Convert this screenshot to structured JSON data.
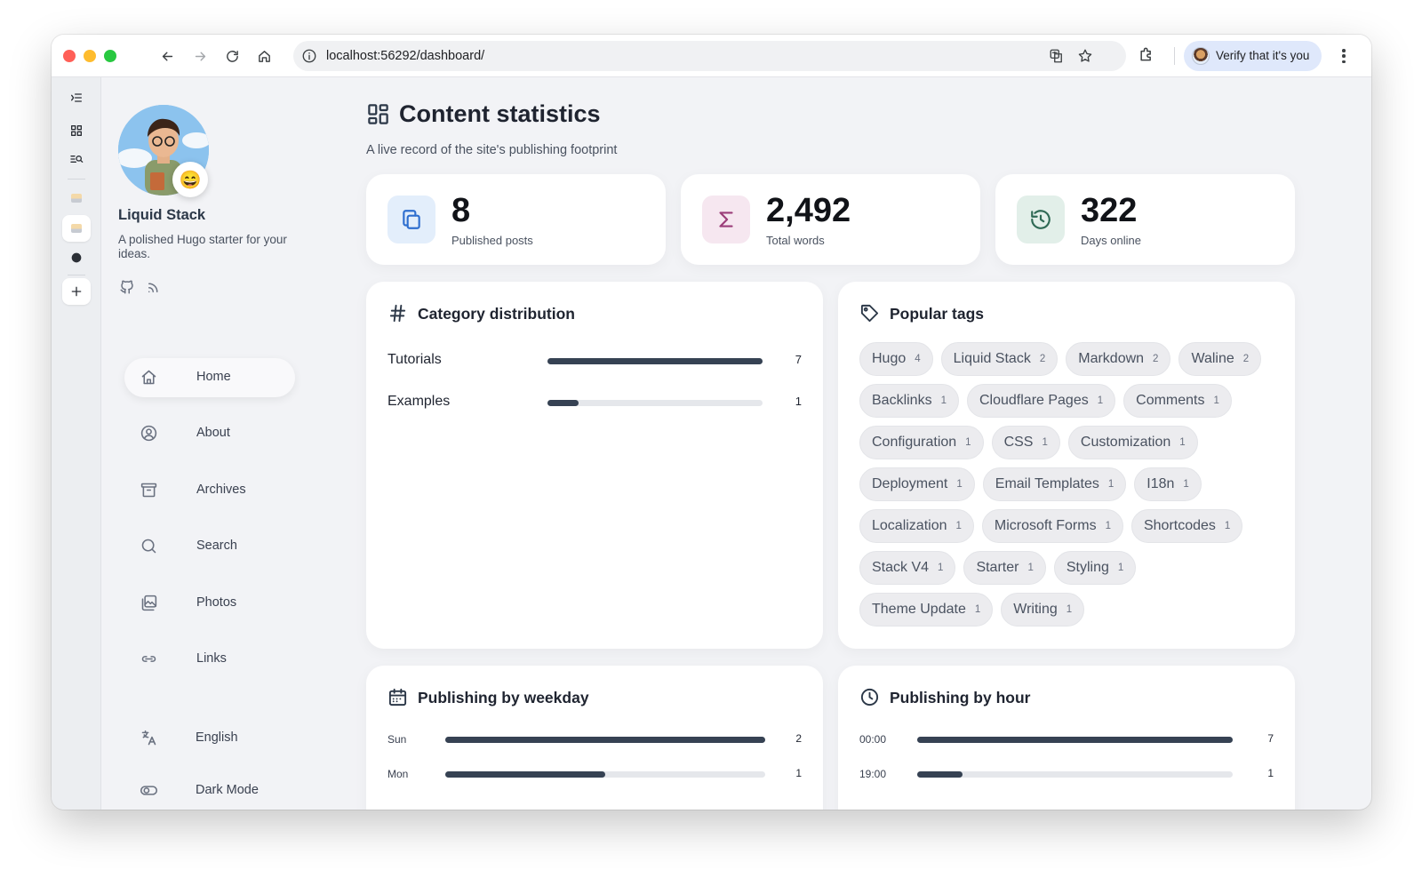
{
  "browser": {
    "url": "localhost:56292/dashboard/",
    "profile_label": "Verify that it's you"
  },
  "site": {
    "title": "Liquid Stack",
    "description": "A polished Hugo starter for your ideas.",
    "avatar_emoji": "😄"
  },
  "menu": [
    {
      "label": "Home",
      "icon": "home-icon",
      "active": true
    },
    {
      "label": "About",
      "icon": "user-circle-icon"
    },
    {
      "label": "Archives",
      "icon": "archive-icon"
    },
    {
      "label": "Search",
      "icon": "search-icon"
    },
    {
      "label": "Photos",
      "icon": "photos-icon"
    },
    {
      "label": "Links",
      "icon": "link-icon"
    }
  ],
  "menu_bottom": [
    {
      "label": "English",
      "icon": "language-icon"
    },
    {
      "label": "Dark Mode",
      "icon": "toggle-icon"
    }
  ],
  "page": {
    "title": "Content statistics",
    "subtitle": "A live record of the site's publishing footprint"
  },
  "stats": [
    {
      "value": "8",
      "label": "Published posts",
      "icon": "copy-icon",
      "accent": "#2f6fcf",
      "bg": "#e3eefb"
    },
    {
      "value": "2,492",
      "label": "Total words",
      "icon": "sigma-icon",
      "accent": "#9b3d79",
      "bg": "#f6e7f0"
    },
    {
      "value": "322",
      "label": "Days online",
      "icon": "history-icon",
      "accent": "#2f6a55",
      "bg": "#e2efe9"
    }
  ],
  "categories": {
    "title": "Category distribution",
    "items": [
      {
        "label": "Tutorials",
        "count": "7",
        "fraction": 1.0
      },
      {
        "label": "Examples",
        "count": "1",
        "fraction": 0.143
      }
    ]
  },
  "tags": {
    "title": "Popular tags",
    "items": [
      {
        "name": "Hugo",
        "count": "4"
      },
      {
        "name": "Liquid Stack",
        "count": "2"
      },
      {
        "name": "Markdown",
        "count": "2"
      },
      {
        "name": "Waline",
        "count": "2"
      },
      {
        "name": "Backlinks",
        "count": "1"
      },
      {
        "name": "Cloudflare Pages",
        "count": "1"
      },
      {
        "name": "Comments",
        "count": "1"
      },
      {
        "name": "Configuration",
        "count": "1"
      },
      {
        "name": "CSS",
        "count": "1"
      },
      {
        "name": "Customization",
        "count": "1"
      },
      {
        "name": "Deployment",
        "count": "1"
      },
      {
        "name": "Email Templates",
        "count": "1"
      },
      {
        "name": "I18n",
        "count": "1"
      },
      {
        "name": "Localization",
        "count": "1"
      },
      {
        "name": "Microsoft Forms",
        "count": "1"
      },
      {
        "name": "Shortcodes",
        "count": "1"
      },
      {
        "name": "Stack V4",
        "count": "1"
      },
      {
        "name": "Starter",
        "count": "1"
      },
      {
        "name": "Styling",
        "count": "1"
      },
      {
        "name": "Theme Update",
        "count": "1"
      },
      {
        "name": "Writing",
        "count": "1"
      }
    ]
  },
  "weekday": {
    "title": "Publishing by weekday",
    "items": [
      {
        "label": "Sun",
        "count": "2",
        "fraction": 1.0
      },
      {
        "label": "Mon",
        "count": "1",
        "fraction": 0.5
      }
    ]
  },
  "hour": {
    "title": "Publishing by hour",
    "items": [
      {
        "label": "00:00",
        "count": "7",
        "fraction": 1.0
      },
      {
        "label": "19:00",
        "count": "1",
        "fraction": 0.143
      }
    ]
  }
}
